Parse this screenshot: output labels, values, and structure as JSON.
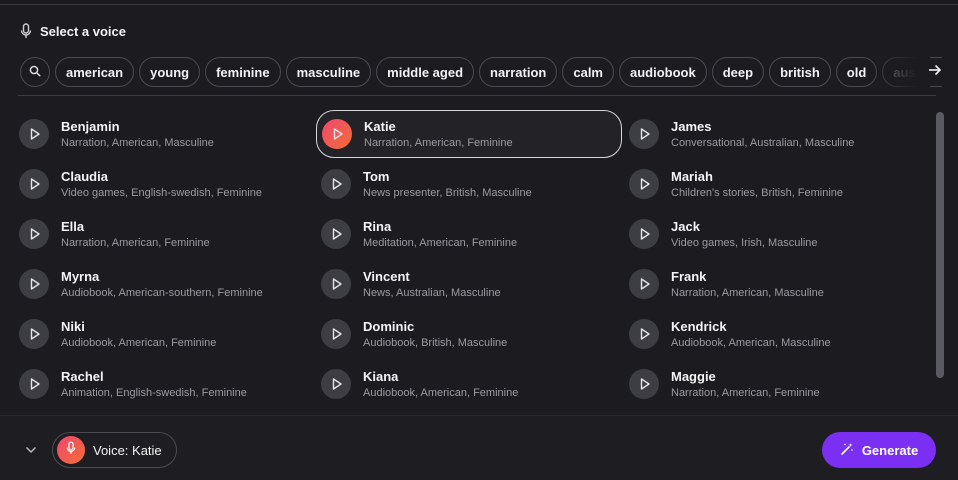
{
  "header": {
    "title": "Select a voice",
    "icon": "microphone-icon"
  },
  "filters": {
    "search_icon": "search-icon",
    "chips": [
      "american",
      "young",
      "feminine",
      "masculine",
      "middle aged",
      "narration",
      "calm",
      "audiobook",
      "deep",
      "british",
      "old"
    ],
    "overflow_chip": "austr",
    "next_icon": "arrow-right-icon"
  },
  "voices": [
    {
      "name": "Benjamin",
      "desc": "Narration, American, Masculine"
    },
    {
      "name": "Katie",
      "desc": "Narration, American, Feminine",
      "selected": true
    },
    {
      "name": "James",
      "desc": "Conversational, Australian, Masculine"
    },
    {
      "name": "Claudia",
      "desc": "Video games, English-swedish, Feminine"
    },
    {
      "name": "Tom",
      "desc": "News presenter, British, Masculine"
    },
    {
      "name": "Mariah",
      "desc": "Children's stories, British, Feminine"
    },
    {
      "name": "Ella",
      "desc": "Narration, American, Feminine"
    },
    {
      "name": "Rina",
      "desc": "Meditation, American, Feminine"
    },
    {
      "name": "Jack",
      "desc": "Video games, Irish, Masculine"
    },
    {
      "name": "Myrna",
      "desc": "Audiobook, American-southern, Feminine"
    },
    {
      "name": "Vincent",
      "desc": "News, Australian, Masculine"
    },
    {
      "name": "Frank",
      "desc": "Narration, American, Masculine"
    },
    {
      "name": "Niki",
      "desc": "Audiobook, American, Feminine"
    },
    {
      "name": "Dominic",
      "desc": "Audiobook, British, Masculine"
    },
    {
      "name": "Kendrick",
      "desc": "Audiobook, American, Masculine"
    },
    {
      "name": "Rachel",
      "desc": "Animation, English-swedish, Feminine"
    },
    {
      "name": "Kiana",
      "desc": "Audiobook, American, Feminine"
    },
    {
      "name": "Maggie",
      "desc": "Narration, American, Feminine"
    }
  ],
  "footer": {
    "voice_label": "Voice: Katie",
    "generate_label": "Generate"
  },
  "colors": {
    "accent": "#7b2ff2",
    "selected_gradient_start": "#f04a6a",
    "selected_gradient_end": "#f26a3a",
    "background": "#1c1c20"
  }
}
